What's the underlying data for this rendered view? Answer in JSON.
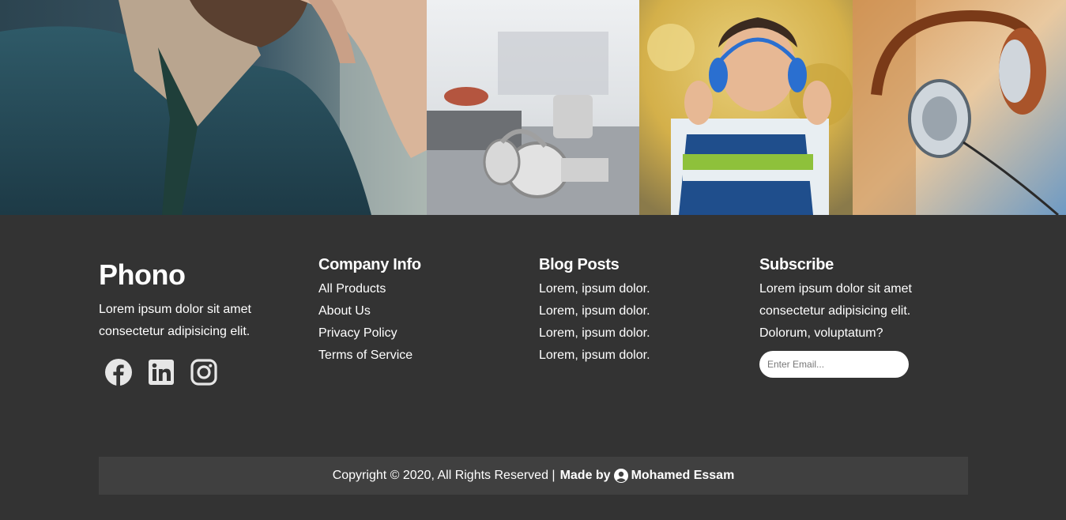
{
  "footer": {
    "brand": "Phono",
    "about_text": "Lorem ipsum dolor sit amet consectetur adipisicing elit.",
    "social": [
      {
        "icon": "facebook-icon"
      },
      {
        "icon": "linkedin-icon"
      },
      {
        "icon": "instagram-icon"
      }
    ],
    "company": {
      "heading": "Company Info",
      "links": [
        "All Products",
        "About Us",
        "Privacy Policy",
        "Terms of Service"
      ]
    },
    "blog": {
      "heading": "Blog Posts",
      "posts": [
        "Lorem, ipsum dolor.",
        "Lorem, ipsum dolor.",
        "Lorem, ipsum dolor.",
        "Lorem, ipsum dolor."
      ]
    },
    "subscribe": {
      "heading": "Subscribe",
      "text": "Lorem ipsum dolor sit amet consectetur adipisicing elit. Dolorum, voluptatum?",
      "email_placeholder": "Enter Email..."
    },
    "copyright": {
      "text": "Copyright © 2020, All Rights Reserved |",
      "made_by": "Made by",
      "author": "Mohamed Essam",
      "author_icon": "user-circle-icon"
    }
  },
  "colors": {
    "footer_bg": "#333333",
    "copyright_bg": "#404040",
    "text": "#ffffff"
  }
}
